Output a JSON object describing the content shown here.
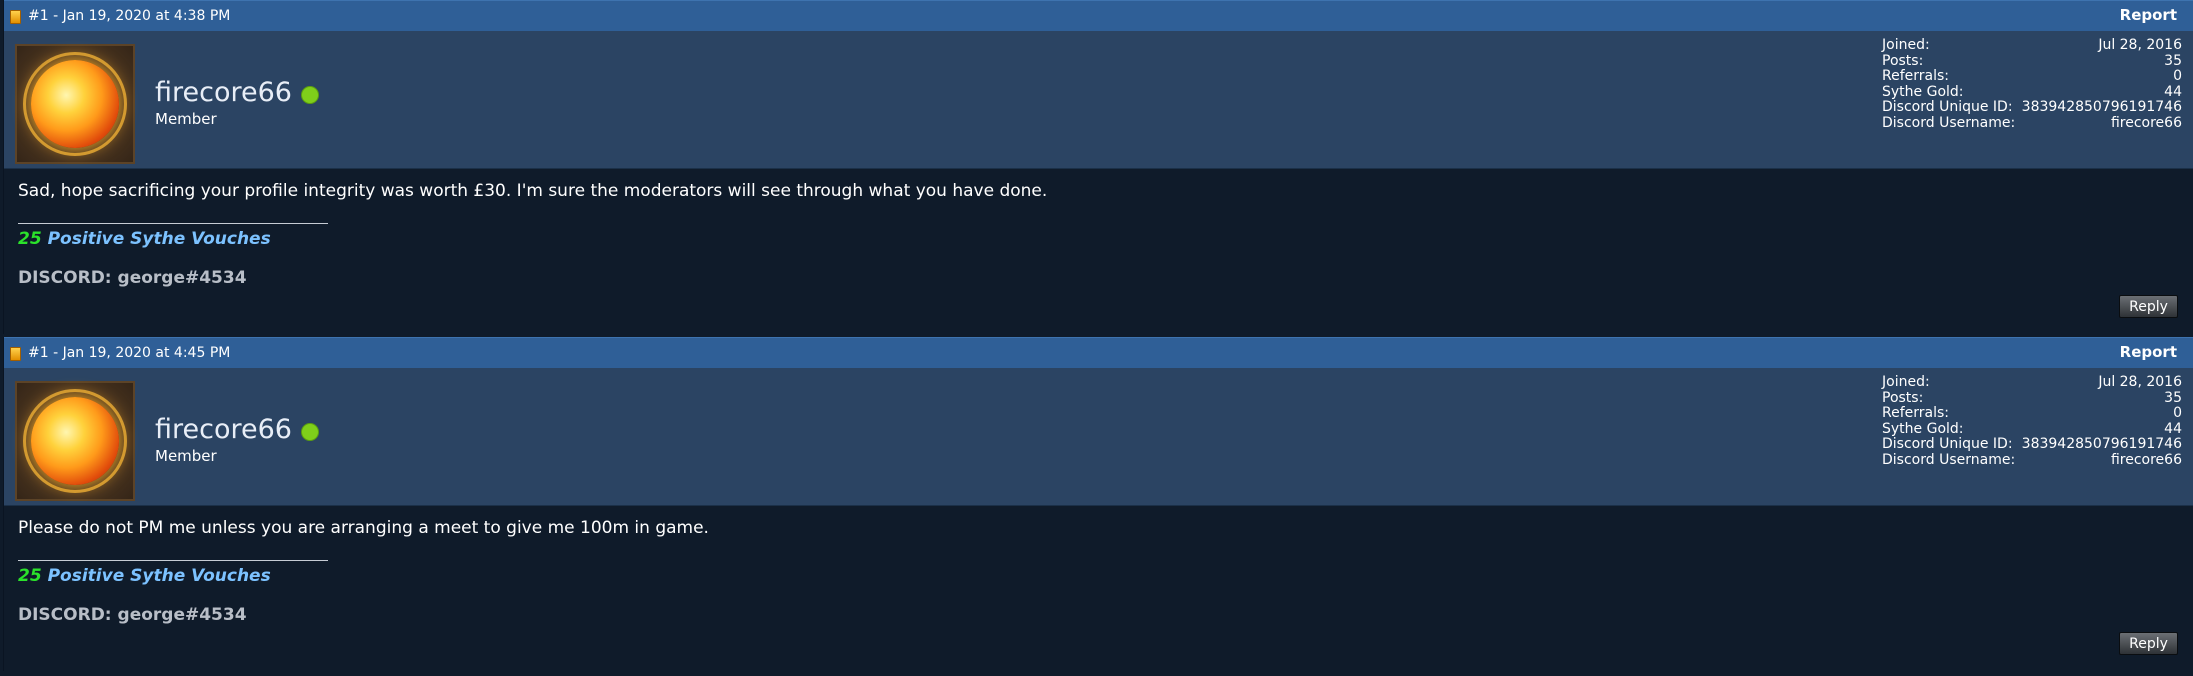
{
  "posts": [
    {
      "meta": "#1 - Jan 19, 2020 at 4:38 PM",
      "report_label": "Report",
      "username": "firecore66",
      "user_title": "Member",
      "stats": [
        {
          "label": "Joined:",
          "value": "Jul 28, 2016"
        },
        {
          "label": "Posts:",
          "value": "35"
        },
        {
          "label": "Referrals:",
          "value": "0"
        },
        {
          "label": "Sythe Gold:",
          "value": "44"
        },
        {
          "label": "Discord Unique ID:",
          "value": "383942850796191746"
        },
        {
          "label": "Discord Username:",
          "value": "firecore66"
        }
      ],
      "message": "Sad, hope sacrificing your profile integrity was worth £30. I'm sure the moderators will see through what you have done.",
      "vouch_count": "25",
      "vouch_text": "Positive Sythe Vouches",
      "discord": "DISCORD: george#4534",
      "reply_label": "Reply"
    },
    {
      "meta": "#1 - Jan 19, 2020 at 4:45 PM",
      "report_label": "Report",
      "username": "firecore66",
      "user_title": "Member",
      "stats": [
        {
          "label": "Joined:",
          "value": "Jul 28, 2016"
        },
        {
          "label": "Posts:",
          "value": "35"
        },
        {
          "label": "Referrals:",
          "value": "0"
        },
        {
          "label": "Sythe Gold:",
          "value": "44"
        },
        {
          "label": "Discord Unique ID:",
          "value": "383942850796191746"
        },
        {
          "label": "Discord Username:",
          "value": "firecore66"
        }
      ],
      "message": "Please do not PM me unless you are arranging a meet to give me 100m in game.",
      "vouch_count": "25",
      "vouch_text": "Positive Sythe Vouches",
      "discord": "DISCORD: george#4534",
      "reply_label": "Reply"
    }
  ],
  "colors": {
    "header_bar": "#2f5f97",
    "user_bar": "#2b4463",
    "body_bg": "#0f1b2a",
    "online": "#7fcf1a",
    "vouch_count": "#2be22b",
    "vouch_text": "#7cc2ff"
  },
  "icons": {
    "post_icon": "post-status-icon",
    "online": "online-indicator-icon"
  }
}
